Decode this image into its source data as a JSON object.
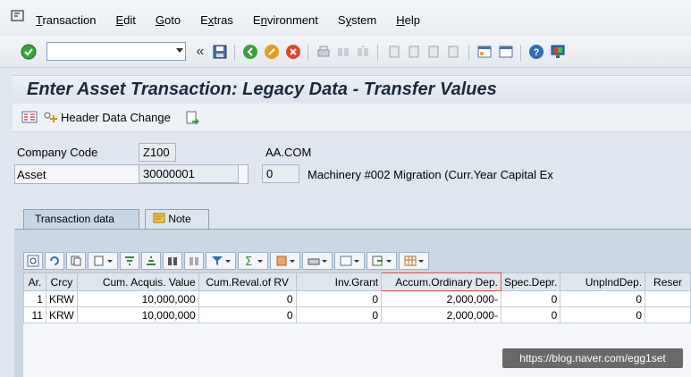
{
  "menu": [
    "Transaction",
    "Edit",
    "Goto",
    "Extras",
    "Environment",
    "System",
    "Help"
  ],
  "menu_underline": [
    "T",
    "E",
    "G",
    "x",
    "n",
    "y",
    "H"
  ],
  "command_field": {
    "value": "",
    "placeholder": ""
  },
  "title": "Enter Asset Transaction: Legacy Data - Transfer Values",
  "app_toolbar": {
    "header_change": "Header Data Change"
  },
  "header": {
    "company_code_label": "Company Code",
    "company_code": "Z100",
    "company_name": "AA.COM",
    "asset_label": "Asset",
    "asset_number": "30000001",
    "asset_sub": "0",
    "asset_desc": "Machinery #002 Migration (Curr.Year Capital Ex"
  },
  "tabs": [
    "Transaction data",
    "Note"
  ],
  "grid": {
    "columns": [
      "Ar.",
      "Crcy",
      "Cum. Acquis. Value",
      "Cum.Reval.of RV",
      "Inv.Grant",
      "Accum.Ordinary Dep.",
      "Spec.Depr.",
      "UnplndDep.",
      "Reser"
    ],
    "rows": [
      [
        "1",
        "KRW",
        "10,000,000",
        "0",
        "0",
        "2,000,000-",
        "0",
        "0",
        ""
      ],
      [
        "11",
        "KRW",
        "10,000,000",
        "0",
        "0",
        "2,000,000-",
        "0",
        "0",
        ""
      ]
    ]
  },
  "watermark": "https://blog.naver.com/egg1set",
  "colors": {
    "accent_yellow": "#fbdc8d",
    "title": "#1b2a3a"
  }
}
